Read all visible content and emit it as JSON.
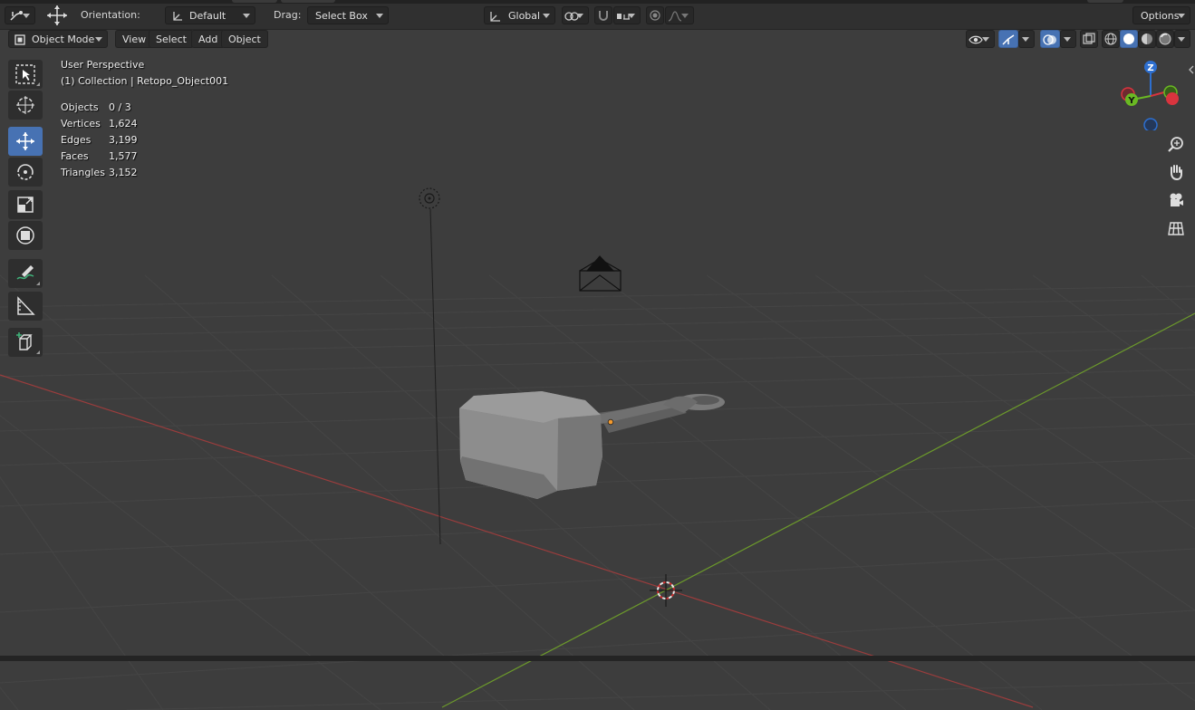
{
  "header": {
    "orientation_label": "Orientation:",
    "orientation_value": "Default",
    "drag_label": "Drag:",
    "drag_value": "Select Box",
    "transform_space": "Global",
    "options_label": "Options"
  },
  "menu": {
    "mode": "Object Mode",
    "view": "View",
    "select": "Select",
    "add": "Add",
    "object": "Object"
  },
  "viewport": {
    "perspective": "User Perspective",
    "collection_info": "(1) Collection | Retopo_Object001",
    "stats": [
      {
        "label": "Objects",
        "value": "0 / 3"
      },
      {
        "label": "Vertices",
        "value": "1,624"
      },
      {
        "label": "Edges",
        "value": "3,199"
      },
      {
        "label": "Faces",
        "value": "1,577"
      },
      {
        "label": "Triangles",
        "value": "3,152"
      }
    ]
  },
  "gizmo": {
    "z_label": "Z",
    "y_label": "Y"
  },
  "toolbar": {
    "tools": [
      "select-box-tool",
      "cursor-tool",
      "move-tool",
      "rotate-tool",
      "scale-tool",
      "transform-tool",
      "annotate-tool",
      "measure-tool",
      "add-cube-tool"
    ],
    "active": "move-tool"
  },
  "colors": {
    "viewport_bg": "#3d3d3d",
    "active_blue": "#4772b3",
    "x_axis": "#8a3a3a",
    "y_axis": "#6a8f2e",
    "gizmo_z": "#2d6fd0",
    "gizmo_y": "#6ab923",
    "gizmo_x": "#d9343e"
  }
}
